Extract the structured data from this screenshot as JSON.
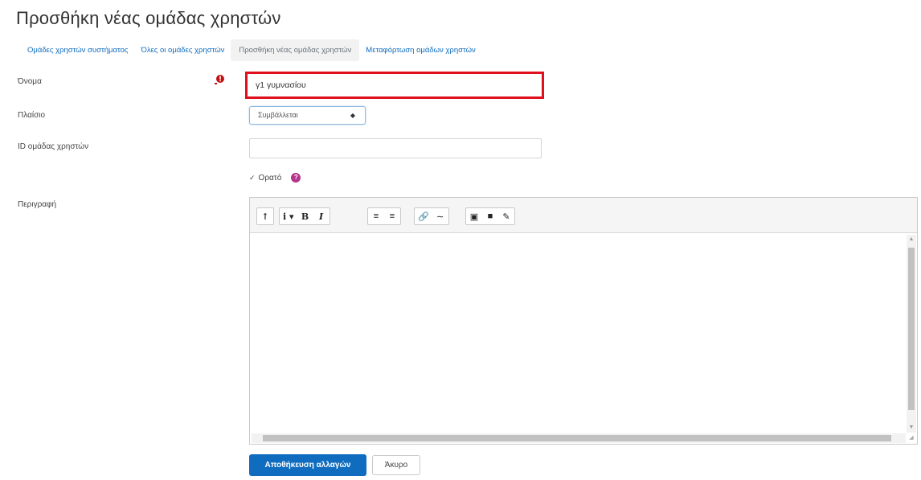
{
  "page": {
    "title": "Προσθήκη νέας ομάδας χρηστών"
  },
  "tabs": [
    {
      "label": "Ομάδες χρηστών συστήματος",
      "active": false
    },
    {
      "label": "Όλες οι ομάδες χρηστών",
      "active": false
    },
    {
      "label": "Προσθήκη νέας ομάδας χρηστών",
      "active": true
    },
    {
      "label": "Μεταφόρτωση ομάδων χρηστών",
      "active": false
    }
  ],
  "form": {
    "name_label": "Όνομα",
    "name_value": "γ1 γυμνασίου",
    "context_label": "Πλαίσιο",
    "context_value": "Συμβάλλεται",
    "idnumber_label": "ID ομάδας χρηστών",
    "idnumber_value": "",
    "visible_label": "Ορατό",
    "description_label": "Περιγραφή",
    "save_label": "Αποθήκευση αλλαγών",
    "cancel_label": "Άκυρο"
  },
  "colors": {
    "link": "#0f6cbf",
    "required": "#c01010",
    "highlight_border": "#e0101d",
    "help": "#b5338b"
  },
  "icons": {
    "required": "exclamation-circle-icon",
    "help": "question-circle-icon",
    "select_caret": "caret-updown-icon"
  }
}
